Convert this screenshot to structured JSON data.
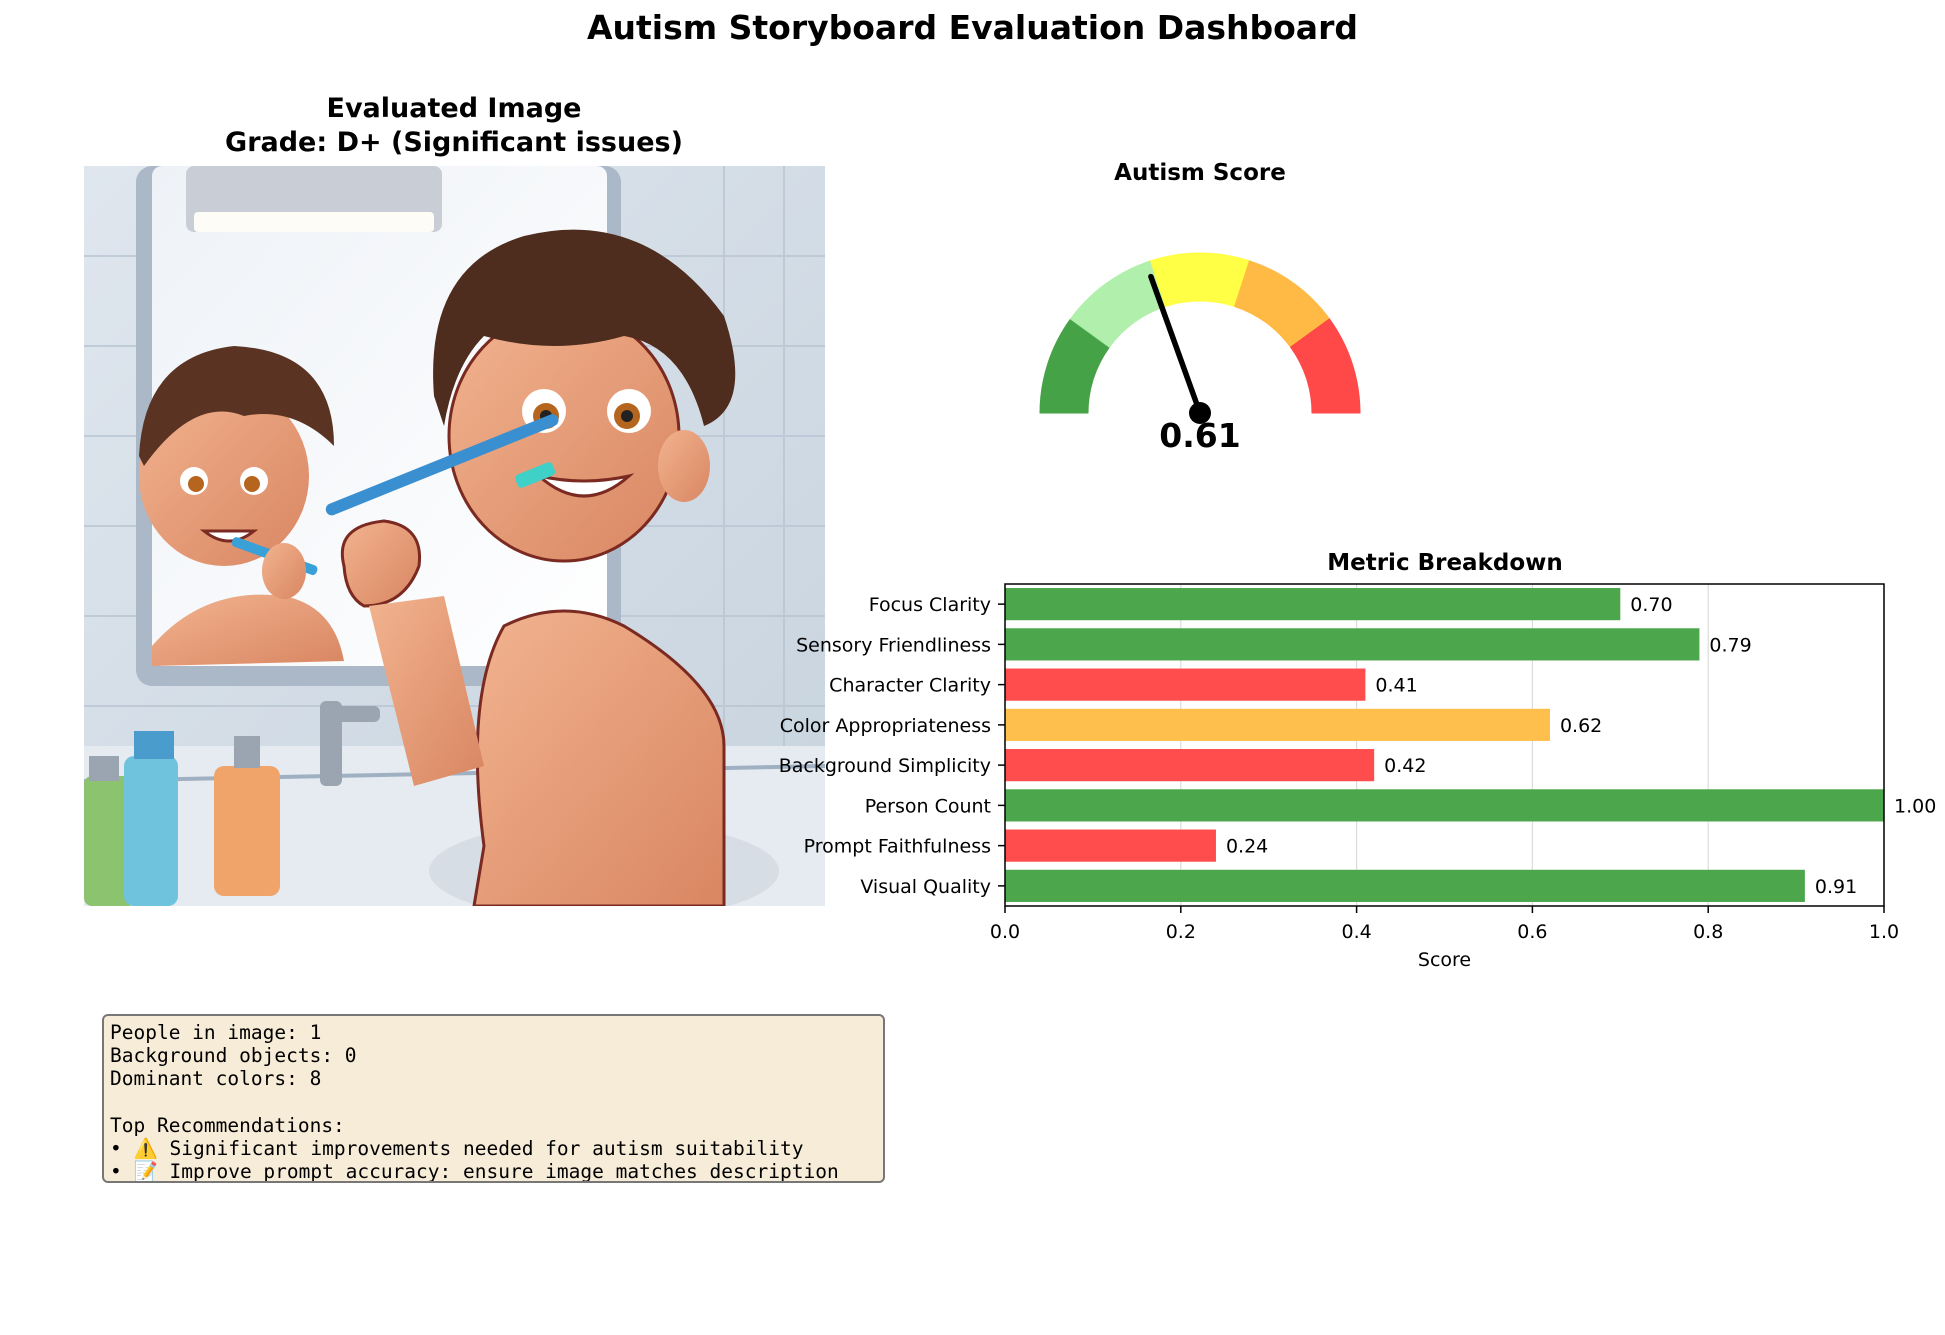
{
  "suptitle": "Autism Storyboard Evaluation Dashboard",
  "image_panel": {
    "title_line1": "Evaluated Image",
    "title_line2": "Grade: D+ (Significant issues)"
  },
  "gauge": {
    "title": "Autism Score",
    "value": 0.61,
    "value_label": "0.61",
    "segment_colors": [
      "#3d9e3d",
      "#adf0a8",
      "#ffff3c",
      "#ffb73c",
      "#ff4040"
    ]
  },
  "chart_data": {
    "type": "bar",
    "orientation": "horizontal",
    "title": "Metric Breakdown",
    "xlabel": "Score",
    "ylabel": "",
    "xlim": [
      0,
      1.0
    ],
    "x_ticks": [
      "0.0",
      "0.2",
      "0.4",
      "0.6",
      "0.8",
      "1.0"
    ],
    "grid": "x",
    "categories": [
      "Focus Clarity",
      "Sensory Friendliness",
      "Character Clarity",
      "Color Appropriateness",
      "Background Simplicity",
      "Person Count",
      "Prompt Faithfulness",
      "Visual Quality"
    ],
    "values": [
      0.7,
      0.79,
      0.41,
      0.62,
      0.42,
      1.0,
      0.24,
      0.91
    ],
    "value_labels": [
      "0.70",
      "0.79",
      "0.41",
      "0.62",
      "0.42",
      "1.00",
      "0.24",
      "0.91"
    ],
    "bar_colors": [
      "#4ca64c",
      "#4ca64c",
      "#ff4d4d",
      "#ffbf4d",
      "#ff4d4d",
      "#4ca64c",
      "#ff4d4d",
      "#4ca64c"
    ]
  },
  "info": {
    "lines": [
      "People in image: 1",
      "Background objects: 0",
      "Dominant colors: 8",
      "",
      "Top Recommendations:",
      "• ⚠️ Significant improvements needed for autism suitability",
      "• 📝 Improve prompt accuracy: ensure image matches description"
    ]
  }
}
